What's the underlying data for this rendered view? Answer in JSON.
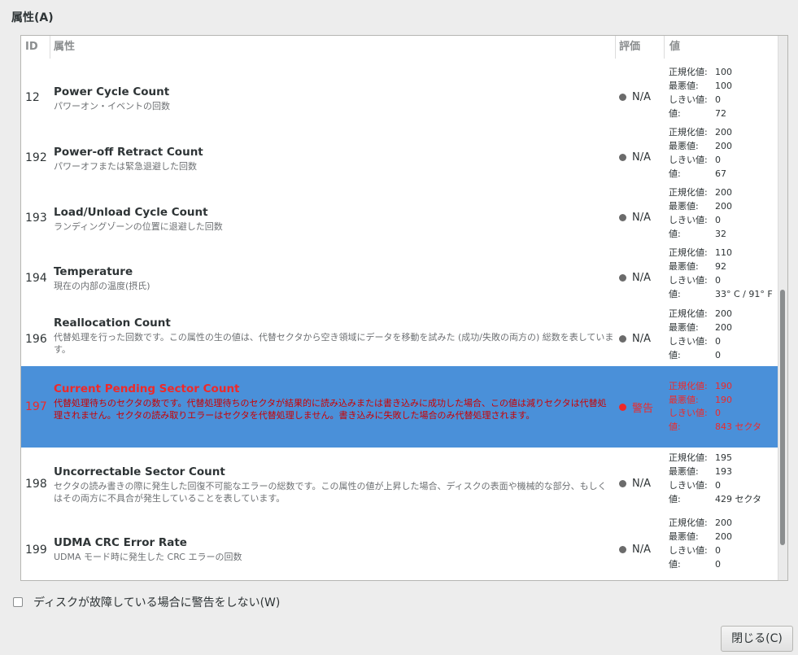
{
  "section_title": "属性(A)",
  "columns": {
    "id": "ID",
    "attribute": "属性",
    "assessment": "評価",
    "value": "値"
  },
  "value_labels": {
    "normalized": "正規化値:",
    "worst": "最悪値:",
    "threshold": "しきい値:",
    "raw": "値:"
  },
  "rows": [
    {
      "id": "12",
      "name": "Power Cycle Count",
      "desc": "パワーオン・イベントの回数",
      "assessment": "N/A",
      "normalized": "100",
      "worst": "100",
      "threshold": "0",
      "raw": "72"
    },
    {
      "id": "192",
      "name": "Power-off Retract Count",
      "desc": "パワーオフまたは緊急退避した回数",
      "assessment": "N/A",
      "normalized": "200",
      "worst": "200",
      "threshold": "0",
      "raw": "67"
    },
    {
      "id": "193",
      "name": "Load/Unload Cycle Count",
      "desc": "ランディングゾーンの位置に退避した回数",
      "assessment": "N/A",
      "normalized": "200",
      "worst": "200",
      "threshold": "0",
      "raw": "32"
    },
    {
      "id": "194",
      "name": "Temperature",
      "desc": "現在の内部の温度(摂氏)",
      "assessment": "N/A",
      "normalized": "110",
      "worst": "92",
      "threshold": "0",
      "raw": "33° C / 91° F"
    },
    {
      "id": "196",
      "name": "Reallocation Count",
      "desc": "代替処理を行った回数です。この属性の生の値は、代替セクタから空き領域にデータを移動を試みた (成功/失敗の両方の) 総数を表しています。",
      "assessment": "N/A",
      "normalized": "200",
      "worst": "200",
      "threshold": "0",
      "raw": "0"
    },
    {
      "id": "197",
      "name": "Current Pending Sector Count",
      "desc": "代替処理待ちのセクタの数です。代替処理待ちのセクタが結果的に読み込みまたは書き込みに成功した場合、この値は減りセクタは代替処理されません。セクタの読み取りエラーはセクタを代替処理しません。書き込みに失敗した場合のみ代替処理されます。",
      "assessment": "警告",
      "normalized": "190",
      "worst": "190",
      "threshold": "0",
      "raw": "843 セクタ"
    },
    {
      "id": "198",
      "name": "Uncorrectable Sector Count",
      "desc": "セクタの読み書きの際に発生した回復不可能なエラーの総数です。この属性の値が上昇した場合、ディスクの表面や機械的な部分、もしくはその両方に不具合が発生していることを表しています。",
      "assessment": "N/A",
      "normalized": "195",
      "worst": "193",
      "threshold": "0",
      "raw": "429 セクタ"
    },
    {
      "id": "199",
      "name": "UDMA CRC Error Rate",
      "desc": "UDMA モード時に発生した CRC エラーの回数",
      "assessment": "N/A",
      "normalized": "200",
      "worst": "200",
      "threshold": "0",
      "raw": "0"
    }
  ],
  "checkbox_label": "ディスクが故障している場合に警告をしない(W)",
  "checkbox_checked": false,
  "close_button": "閉じる(C)",
  "colors": {
    "selection": "#4a90d9",
    "warning": "#ef2929"
  }
}
